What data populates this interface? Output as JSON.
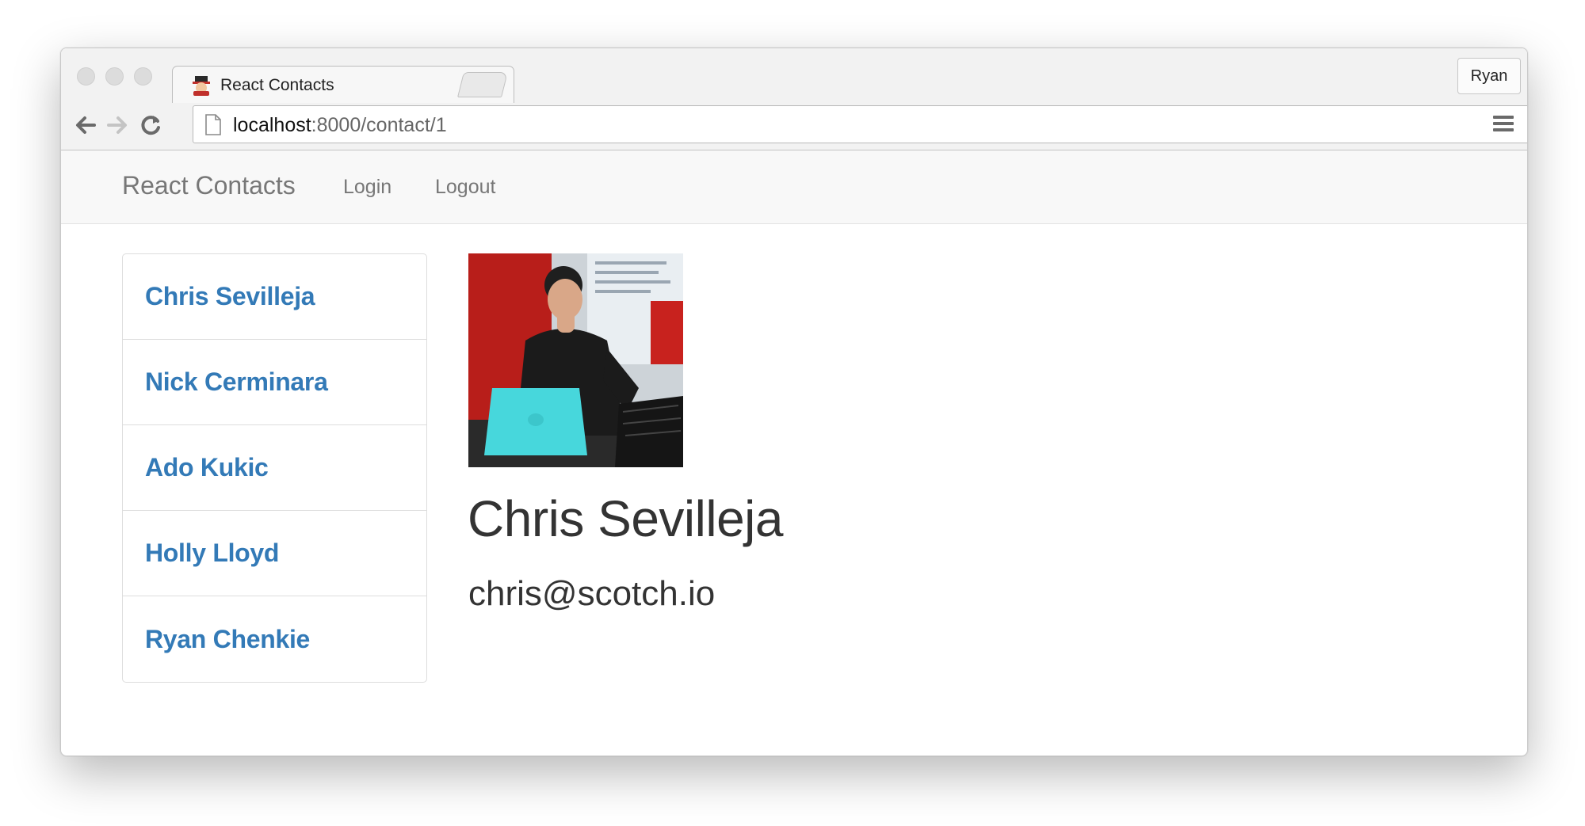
{
  "browser": {
    "tab_title": "React Contacts",
    "tab_close": "×",
    "profile_name": "Ryan",
    "url_host": "localhost",
    "url_rest": ":8000/contact/1"
  },
  "navbar": {
    "brand": "React Contacts",
    "links": [
      "Login",
      "Logout"
    ]
  },
  "contacts": [
    {
      "name": "Chris Sevilleja"
    },
    {
      "name": "Nick Cerminara"
    },
    {
      "name": "Ado Kukic"
    },
    {
      "name": "Holly Lloyd"
    },
    {
      "name": "Ryan Chenkie"
    }
  ],
  "detail": {
    "name": "Chris Sevilleja",
    "email": "chris@scotch.io"
  },
  "colors": {
    "link": "#337ab7",
    "text": "#333333",
    "nav_text": "#777777"
  }
}
